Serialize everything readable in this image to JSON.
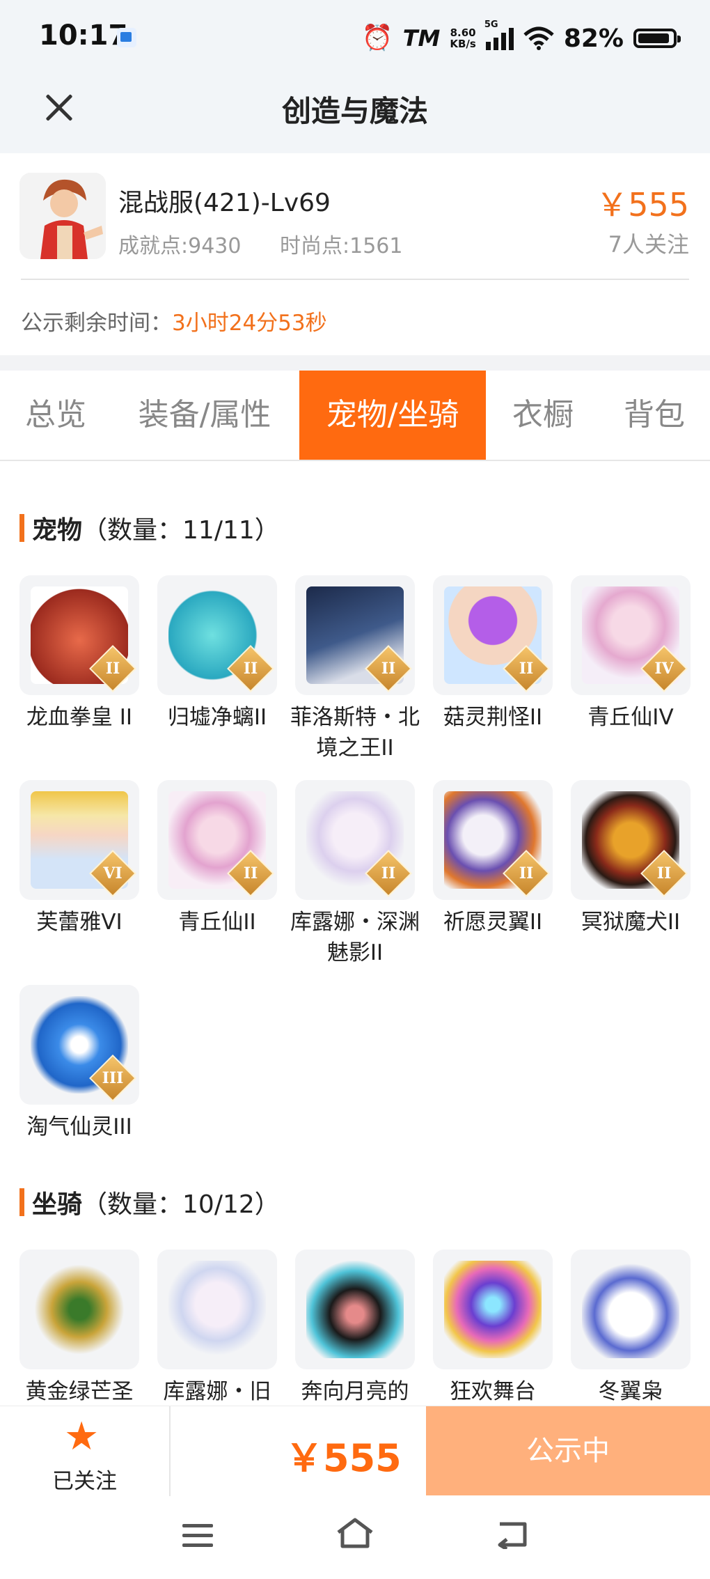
{
  "status_bar": {
    "time": "10:17",
    "net_speed_value": "8.60",
    "net_speed_unit": "KB/s",
    "network": "5G",
    "battery": "82%",
    "icons": [
      "alarm-icon",
      "tm-icon",
      "signal-icon",
      "wifi-icon",
      "battery-icon"
    ]
  },
  "nav": {
    "title": "创造与魔法",
    "close_icon": "close-icon"
  },
  "character": {
    "name": "混战服(421)-Lv69",
    "achievement": "成就点:9430",
    "fashion": "时尚点:1561",
    "price": "￥555",
    "follows": "7人关注",
    "remaining_label": "公示剩余时间：",
    "remaining_value": "3小时24分53秒"
  },
  "tabs": [
    {
      "label": "总览",
      "active": false
    },
    {
      "label": "装备/属性",
      "active": false
    },
    {
      "label": "宠物/坐骑",
      "active": true
    },
    {
      "label": "衣橱",
      "active": false
    },
    {
      "label": "背包",
      "active": false
    }
  ],
  "pets": {
    "title": "宠物",
    "count": "（数量：11/11）",
    "items": [
      {
        "name": "龙血拳皇 II",
        "badge": "II"
      },
      {
        "name": "归墟净螭II",
        "badge": "II"
      },
      {
        "name": "菲洛斯特・北境之王II",
        "badge": "II"
      },
      {
        "name": "菇灵荆怪II",
        "badge": "II"
      },
      {
        "name": "青丘仙IV",
        "badge": "IV"
      },
      {
        "name": "芙蕾雅VI",
        "badge": "VI"
      },
      {
        "name": "青丘仙II",
        "badge": "II"
      },
      {
        "name": "库露娜・深渊魅影II",
        "badge": "II"
      },
      {
        "name": "祈愿灵翼II",
        "badge": "II"
      },
      {
        "name": "冥狱魔犬II",
        "badge": "II"
      },
      {
        "name": "淘气仙灵III",
        "badge": "III"
      }
    ]
  },
  "mounts": {
    "title": "坐骑",
    "count": "（数量：10/12）",
    "items": [
      {
        "name": "黄金绿芒圣"
      },
      {
        "name": "库露娜・旧"
      },
      {
        "name": "奔向月亮的"
      },
      {
        "name": "狂欢舞台"
      },
      {
        "name": "冬翼枭"
      }
    ]
  },
  "bottom_bar": {
    "follow_label": "已关注",
    "price": "￥555",
    "status_button": "公示中"
  },
  "colors": {
    "accent": "#ff6a10",
    "accent_text": "#f2711c",
    "button_disabled": "#ffb07c",
    "header_bg": "#f2f5f8"
  }
}
